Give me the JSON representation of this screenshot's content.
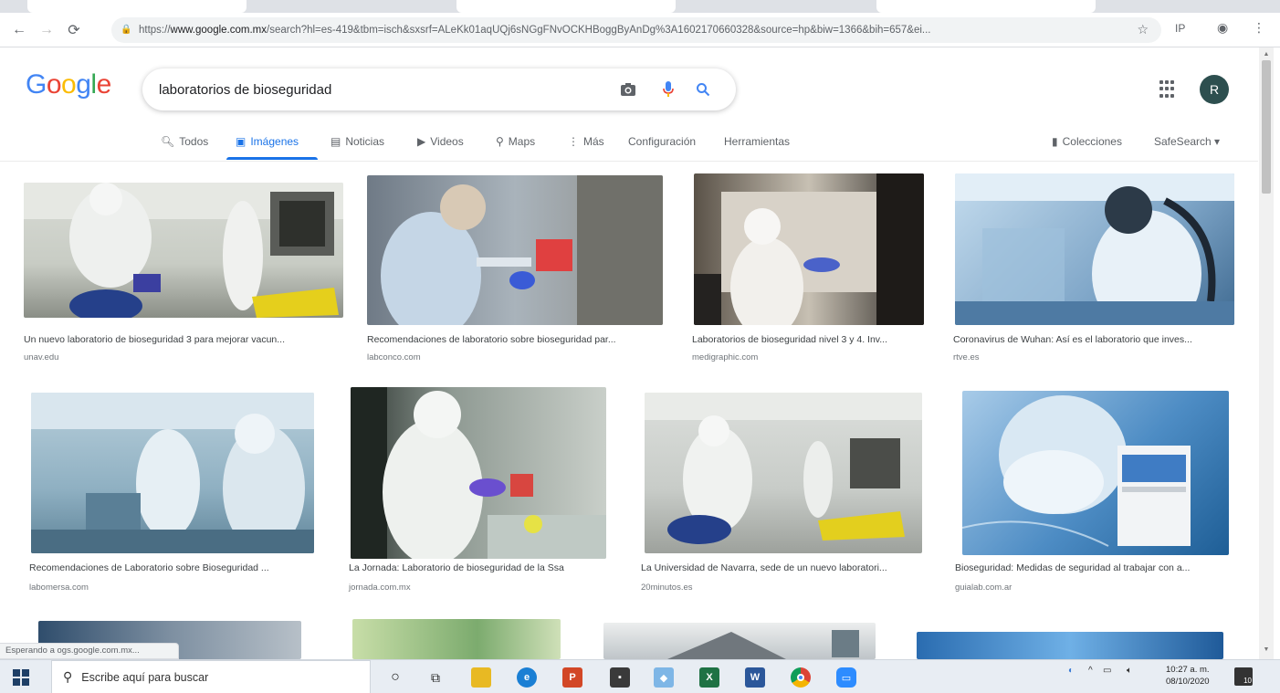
{
  "browser": {
    "url_prefix": "https://",
    "url_host": "www.google.com.mx",
    "url_rest": "/search?hl=es-419&tbm=isch&sxsrf=ALeKk01aqUQj6sNGgFNvOCKHBoggByAnDg%3A1602170660328&source=hp&biw=1366&bih=657&ei...",
    "profile_label": "IP"
  },
  "header": {
    "logo_letters": [
      "G",
      "o",
      "o",
      "g",
      "l",
      "e"
    ],
    "search_query": "laboratorios de bioseguridad",
    "avatar_letter": "R"
  },
  "tabs": [
    {
      "label": "Todos",
      "active": false
    },
    {
      "label": "Imágenes",
      "active": true
    },
    {
      "label": "Noticias",
      "active": false
    },
    {
      "label": "Videos",
      "active": false
    },
    {
      "label": "Maps",
      "active": false
    },
    {
      "label": "Más",
      "active": false
    },
    {
      "label": "Configuración",
      "active": false
    },
    {
      "label": "Herramientas",
      "active": false
    }
  ],
  "tabs_right": {
    "collections_label": "Colecciones",
    "safesearch_label": "SafeSearch ▾"
  },
  "results": [
    {
      "caption": "Un nuevo laboratorio de bioseguridad 3 para mejorar vacun...",
      "source": "unav.edu"
    },
    {
      "caption": "Recomendaciones de laboratorio sobre bioseguridad par...",
      "source": "labconco.com"
    },
    {
      "caption": "Laboratorios de bioseguridad nivel 3 y 4. Inv...",
      "source": "medigraphic.com"
    },
    {
      "caption": "Coronavirus de Wuhan: Así es el laboratorio que inves...",
      "source": "rtve.es"
    },
    {
      "caption": "Recomendaciones de Laboratorio sobre Bioseguridad ...",
      "source": "labomersa.com"
    },
    {
      "caption": "La Jornada: Laboratorio de bioseguridad de la Ssa",
      "source": "jornada.com.mx"
    },
    {
      "caption": "La Universidad de Navarra, sede de un nuevo laboratori...",
      "source": "20minutos.es"
    },
    {
      "caption": "Bioseguridad: Medidas de seguridad al trabajar con a...",
      "source": "guialab.com.ar"
    }
  ],
  "status_bar": "Esperando a ogs.google.com.mx...",
  "taskbar": {
    "search_placeholder": "Escribe aquí para buscar",
    "time": "10:27 a. m.",
    "date": "08/10/2020",
    "notification_count": "10"
  }
}
